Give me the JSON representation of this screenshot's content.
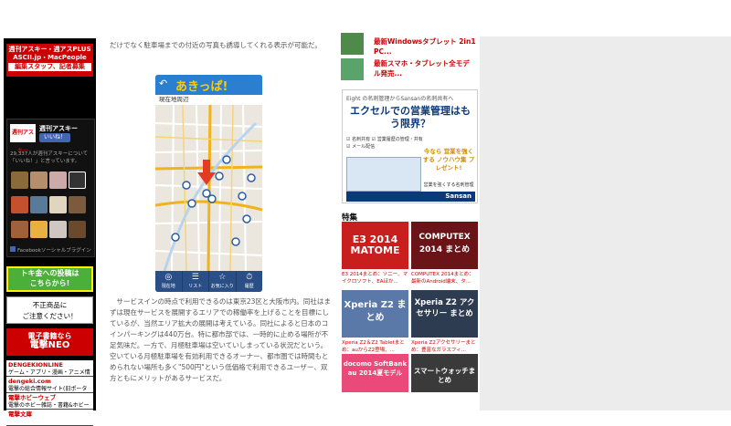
{
  "sidebar": {
    "banner_lines": [
      "週刊アスキー・週アスPLUS",
      "ASCII.jp・MacPeople",
      "編集スタッフ、記者募集"
    ],
    "fb_logo": "週刊アスキー",
    "fb_name": "週刊アスキー",
    "fb_like": "いいね！",
    "fb_count": "29,337人が週刊アスキーについて「いいね！」と言っています。",
    "fb_plugin": "Facebookソーシャルプラグイン",
    "tokyo_line1": "トキ金への投稿は",
    "tokyo_line2": "こちらから!",
    "fusei_line1": "不正商品に",
    "fusei_line2": "ご注意ください！",
    "denki_line1": "電子書籍なら",
    "denki_line2": "電撃NEO",
    "links": [
      {
        "title": "DENGEKIONLINE",
        "sub": "ゲーム・アプリ・漫画・アニメ情報サイト"
      },
      {
        "title": "dengeki.com",
        "sub": "電撃の総合情報サイト(旧ポータル)"
      },
      {
        "title": "電撃ホビーウェブ",
        "sub": "電撃のホビー雑誌・書籍&ホビーニュースサイト"
      },
      {
        "title": "電撃文庫",
        "sub": ""
      }
    ]
  },
  "article": {
    "top_text": "だけでなく駐車場までの付近の写真も誘導してくれる表示が可能だ。",
    "app_logo": "あきっぱ!",
    "map_header": "現在地周辺",
    "tabs": [
      {
        "icon": "◎",
        "label": "現在地"
      },
      {
        "icon": "☰",
        "label": "リスト"
      },
      {
        "icon": "☆",
        "label": "お気に入り"
      },
      {
        "icon": "⏱",
        "label": "履歴"
      }
    ],
    "body_text": "サービスインの時点で利用できるのは東京23区と大阪市内。同社はまずは現在サービスを展開するエリアでの稼働率を上げることを目標にしているが、当然エリア拡大の展開は考えている。同社によると日本のコインパーキングは440万台。特に都市部では、一時的に止める場所が不足気味だ。一方で、月極駐車場は空いていしまっている状況だという。空いている月極駐車場を有効利用できるオーナー、都市圏では時間もとめられない場所も多く\"500円\"という低価格で利用できるユーザー、双方ともにメリットがあるサービスだ。"
  },
  "right": {
    "news": [
      {
        "text": "最新Windowsタブレット 2in1 PC..."
      },
      {
        "text": "最新スマホ・タブレット全モデル発売..."
      }
    ],
    "ad": {
      "eight": "Eight の名刺管理からSansanの名刺共有へ",
      "headline": "エクセルでの営業管理はもう限界？",
      "checks": [
        "☑ 名刺共有 ☑ 営業履歴の管理・共有",
        "☑ メール配信"
      ],
      "promo": "今なら 営業を強くする ノウハウ集 プレゼント!",
      "foot": "営業を強くする名刺管理",
      "brand": "Sansan"
    },
    "feature_heading": "特集",
    "features": [
      {
        "title": "E3 2014 MATOME",
        "caption": "E3 2014まとめ：ソニー、マイクロソフト、EAほか..."
      },
      {
        "title": "COMPUTEX 2014 まとめ",
        "caption": "COMPUTEX 2014まとめ：最新のAndroid端末、タ..."
      },
      {
        "title": "Xperia Z2 まとめ",
        "caption": "Xperia Z2＆Z2 Tabletまとめ：auからZ2登場、..."
      },
      {
        "title": "Xperia Z2 アクセサリー まとめ",
        "caption": "Xperia Z2アクセサリーまとめ：豊富なガラスフィ..."
      },
      {
        "title": "docomo SoftBank au 2014夏モデル",
        "caption": ""
      },
      {
        "title": "スマートウォッチまとめ",
        "caption": ""
      }
    ]
  }
}
